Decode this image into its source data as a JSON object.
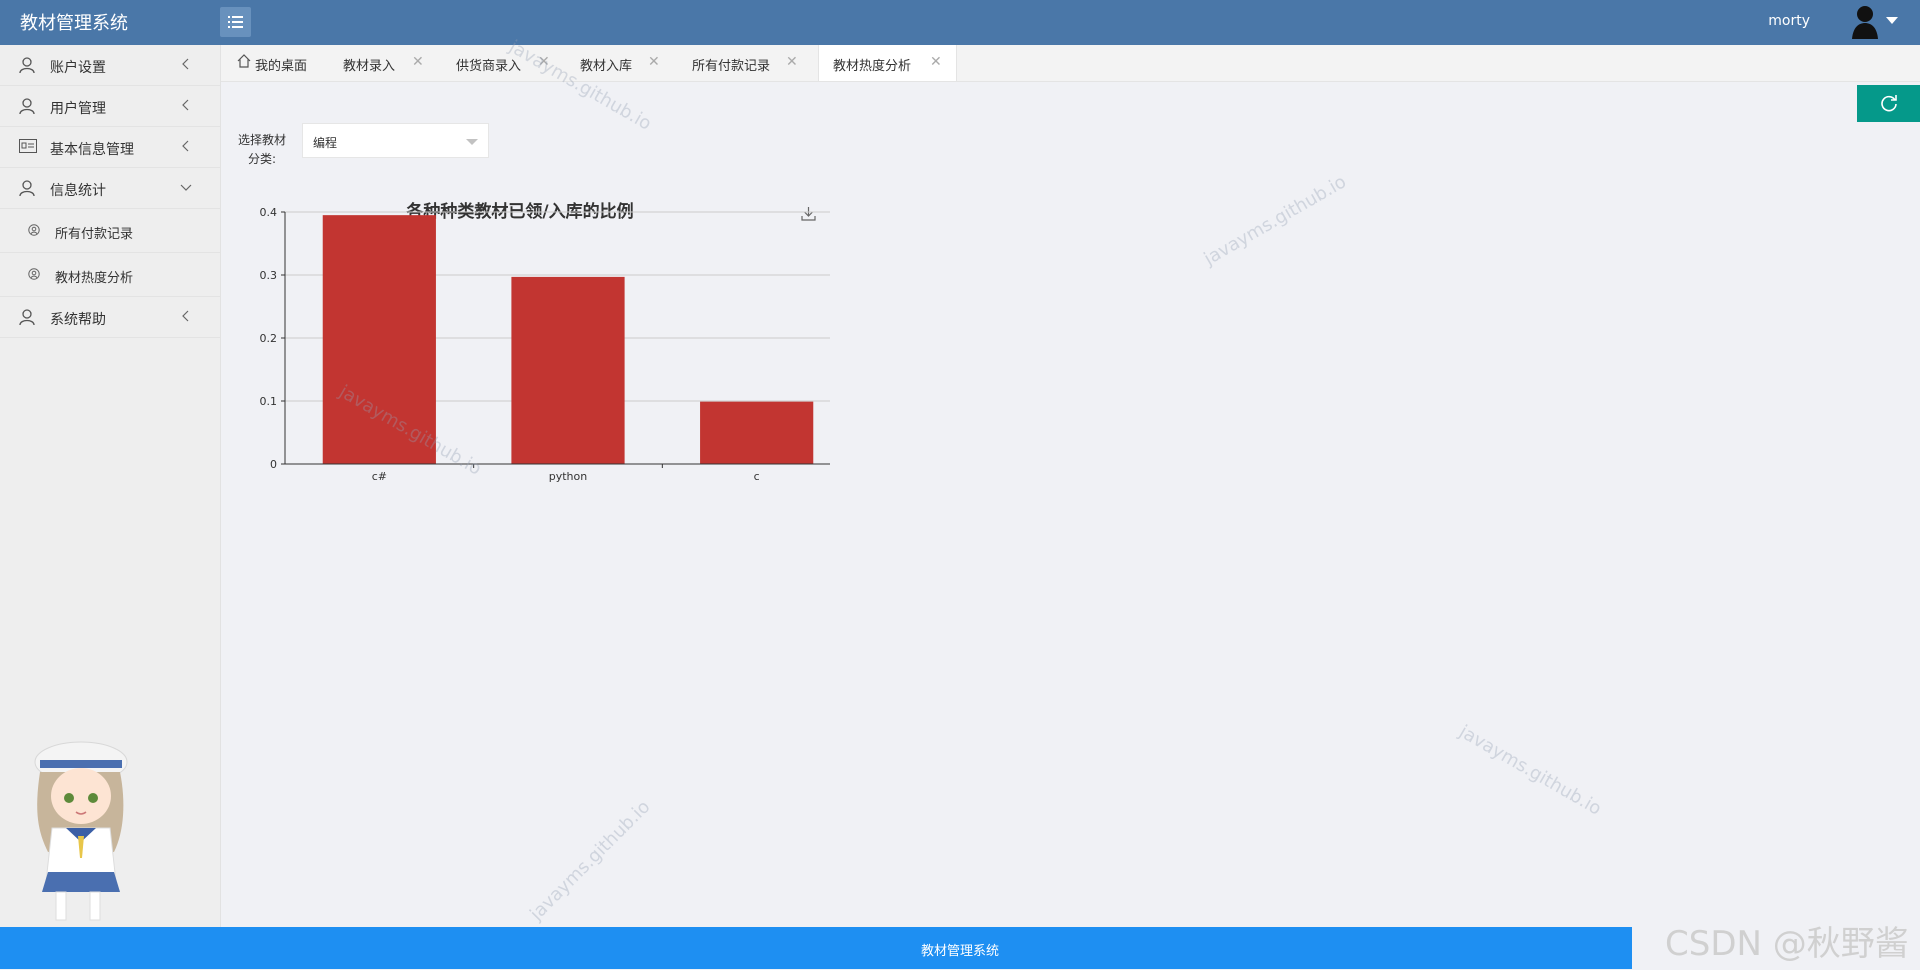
{
  "app": {
    "title": "教材管理系统",
    "user": "morty"
  },
  "sidebar": {
    "items": [
      {
        "label": "账户设置"
      },
      {
        "label": "用户管理"
      },
      {
        "label": "基本信息管理"
      },
      {
        "label": "信息统计"
      },
      {
        "label": "所有付款记录"
      },
      {
        "label": "教材热度分析"
      },
      {
        "label": "系统帮助"
      }
    ]
  },
  "tabs": [
    {
      "label": "我的桌面"
    },
    {
      "label": "教材录入"
    },
    {
      "label": "供货商录入"
    },
    {
      "label": "教材入库"
    },
    {
      "label": "所有付款记录"
    },
    {
      "label": "教材热度分析"
    }
  ],
  "filter": {
    "label_line1": "选择教材",
    "label_line2": "分类:",
    "selected": "编程"
  },
  "chart_data": {
    "type": "bar",
    "title": "各种种类教材已领/入库的比例",
    "categories": [
      "c#",
      "python",
      "c"
    ],
    "values": [
      0.395,
      0.297,
      0.099
    ],
    "ylim": [
      0,
      0.4
    ],
    "yticks": [
      "0",
      "0.1",
      "0.2",
      "0.3",
      "0.4"
    ],
    "bar_color": "#c23531",
    "grid": true
  },
  "footer": {
    "text": "教材管理系统"
  },
  "watermark": {
    "text": "javayms.github.io",
    "csdn": "CSDN @秋野酱"
  },
  "colors": {
    "header": "#4a77a8",
    "accent": "#05998a",
    "footer": "#1e8ff2"
  }
}
